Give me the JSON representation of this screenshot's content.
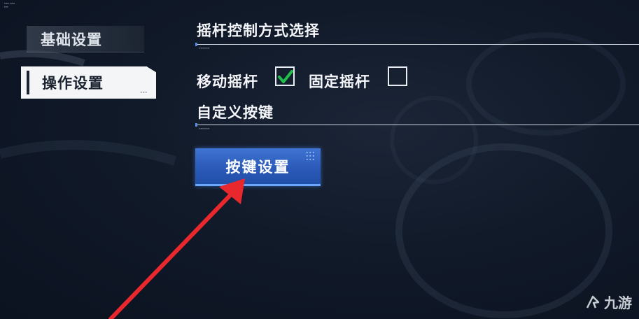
{
  "sidebar": {
    "items": [
      {
        "label": "基础设置",
        "selected": false
      },
      {
        "label": "操作设置",
        "selected": true
      }
    ]
  },
  "joystick_section": {
    "title": "摇杆控制方式选择",
    "options": [
      {
        "label": "移动摇杆",
        "checked": true
      },
      {
        "label": "固定摇杆",
        "checked": false
      }
    ]
  },
  "custom_keys_section": {
    "title": "自定义按键",
    "button_label": "按键设置"
  },
  "watermark": {
    "text": "九游"
  },
  "colors": {
    "background": "#111a29",
    "button": "#2f62c4",
    "check": "#1fbf4a",
    "annotation_arrow": "#e8282c"
  },
  "icons": [
    "checkmark-icon",
    "annotation-arrow",
    "jiuyou-logo-icon"
  ]
}
